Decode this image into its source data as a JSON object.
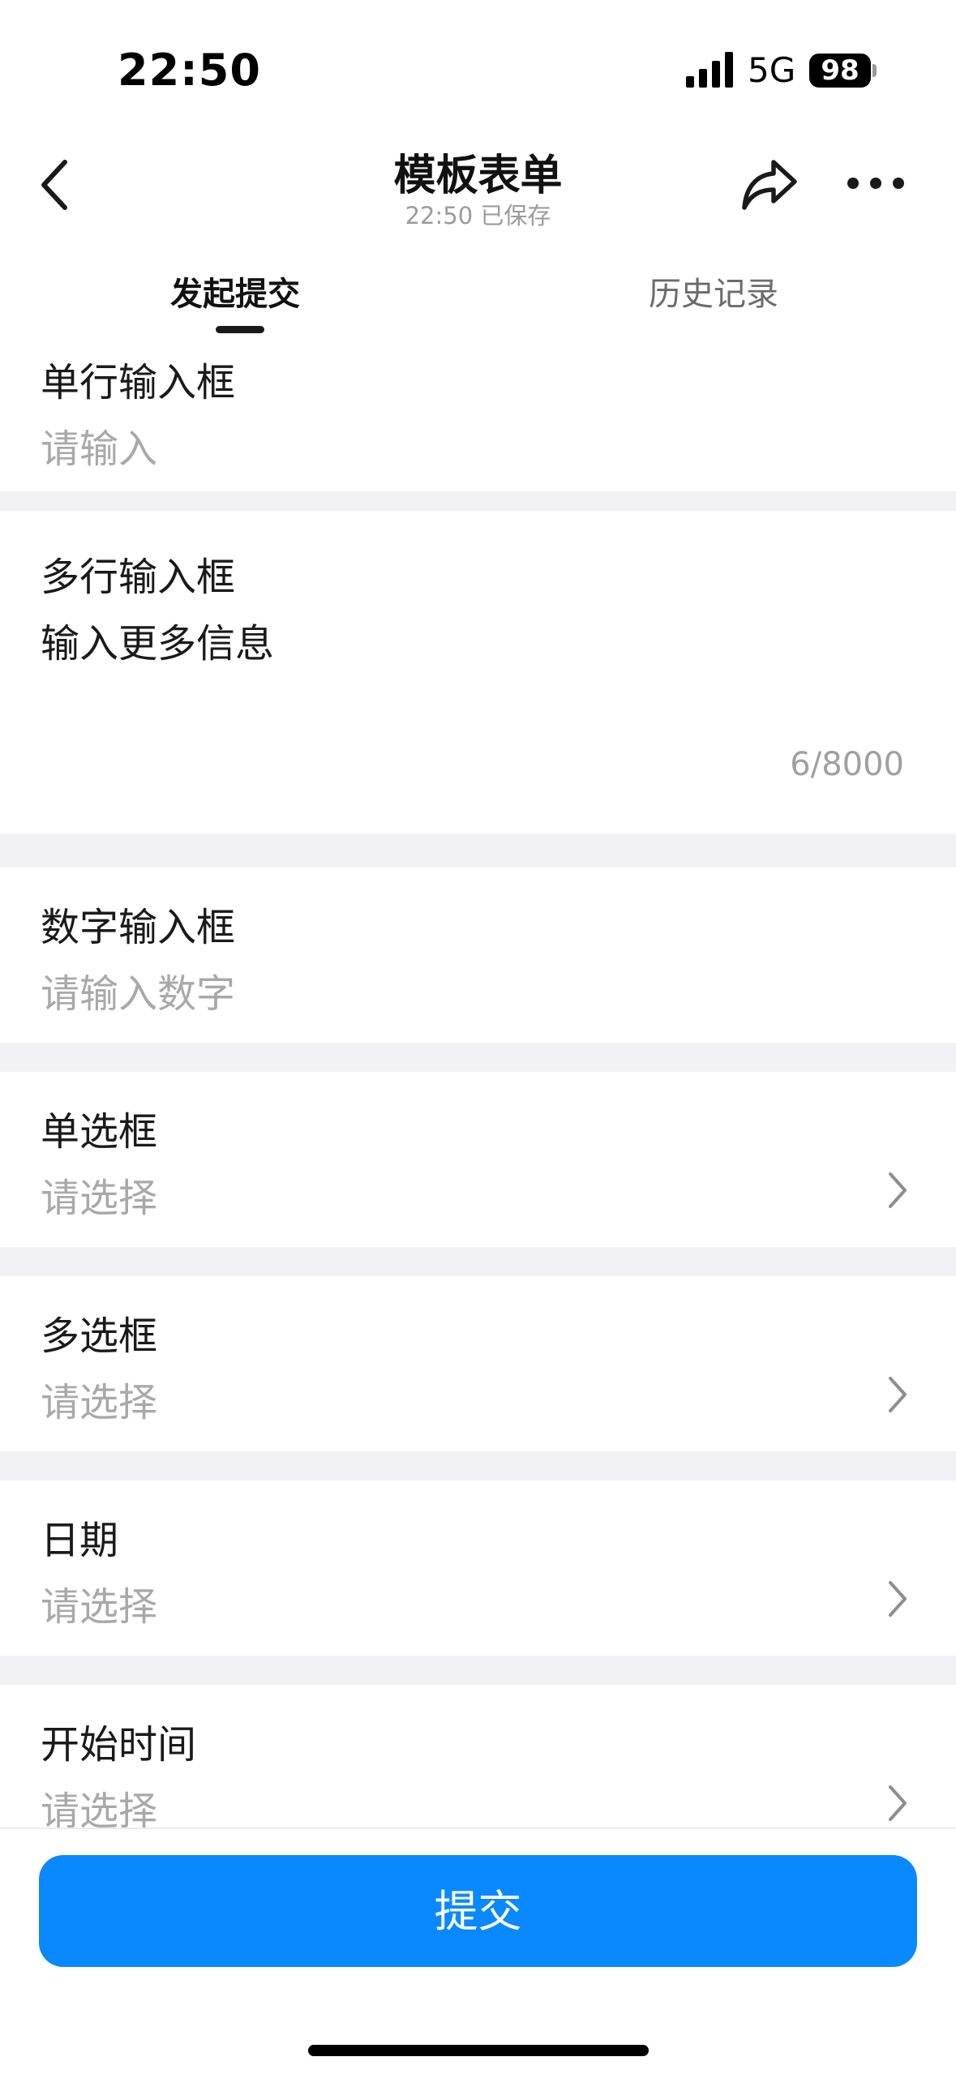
{
  "status_bar": {
    "time": "22:50",
    "network": "5G",
    "battery": "98"
  },
  "nav": {
    "title": "模板表单",
    "subtitle": "22:50 已保存",
    "icons": {
      "back": "chevron-left-icon",
      "share": "share-arrow-icon",
      "more": "more-dots-icon"
    }
  },
  "tabs": [
    {
      "label": "发起提交",
      "active": true
    },
    {
      "label": "历史记录",
      "active": false
    }
  ],
  "form": {
    "fields": [
      {
        "label": "单行输入框",
        "value": "请输入",
        "kind": "text"
      },
      {
        "label": "多行输入框",
        "value": "输入更多信息",
        "counter": "6/8000",
        "kind": "textarea"
      },
      {
        "label": "数字输入框",
        "value": "请输入数字",
        "kind": "number"
      },
      {
        "label": "单选框",
        "value": "请选择",
        "kind": "picker"
      },
      {
        "label": "多选框",
        "value": "请选择",
        "kind": "picker"
      },
      {
        "label": "日期",
        "value": "请选择",
        "kind": "picker"
      },
      {
        "label": "开始时间",
        "value": "请选择",
        "kind": "picker"
      }
    ]
  },
  "submit": {
    "label": "提交"
  },
  "colors": {
    "primary": "#0a89ff",
    "placeholder": "#a9a9a9",
    "section_gap": "#f2f2f6"
  }
}
